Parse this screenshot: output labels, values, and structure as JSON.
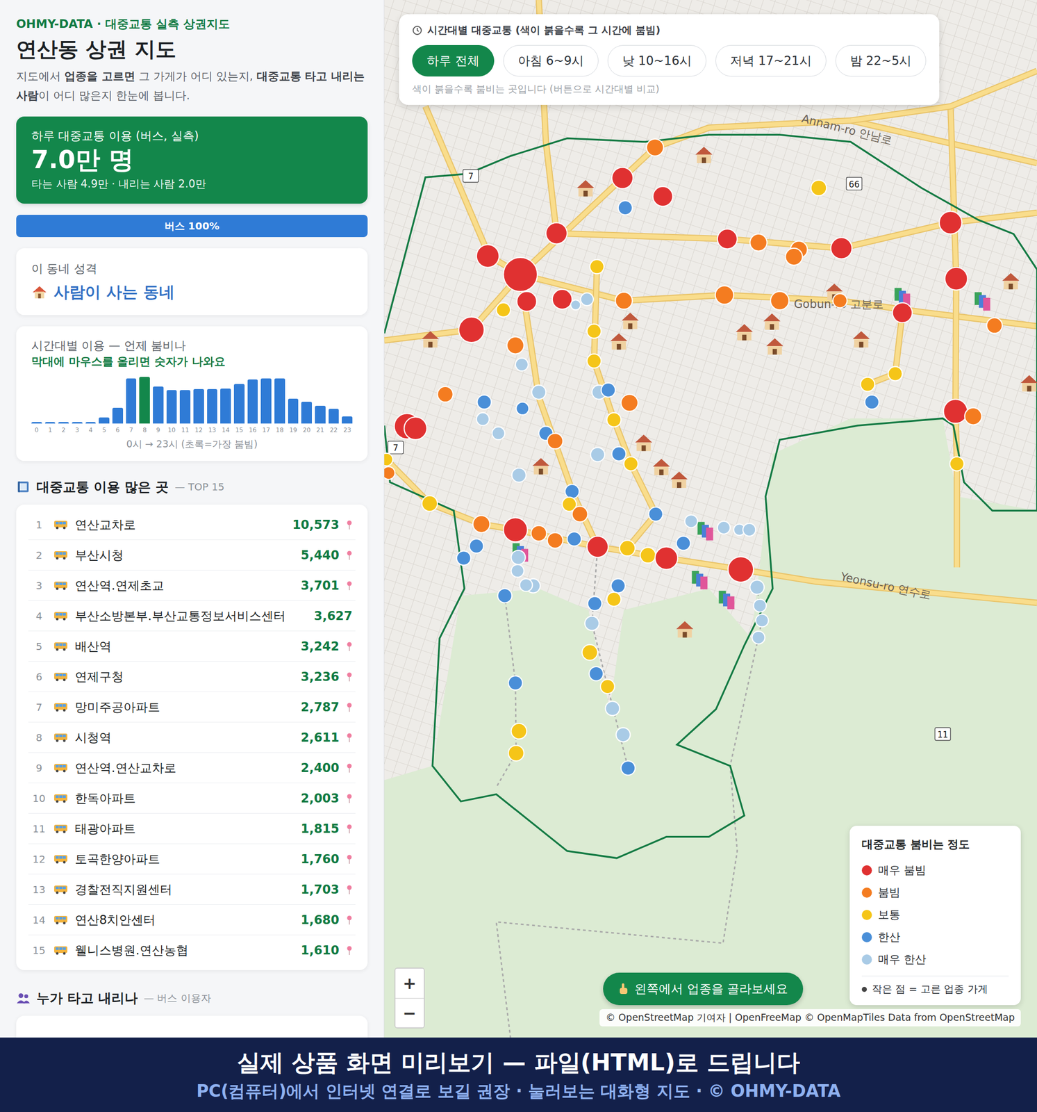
{
  "header": {
    "kicker": "OHMY-DATA · 대중교통 실측 상권지도",
    "title": "연산동 상권 지도",
    "description": [
      {
        "text": "지도에서 ",
        "bold": false
      },
      {
        "text": "업종을 고르면",
        "bold": true
      },
      {
        "text": " 그 가게가 어디 있는지, ",
        "bold": false
      },
      {
        "text": "대중교통 타고 내리는 사람",
        "bold": true
      },
      {
        "text": "이 어디 많은지 한눈에 봅니다.",
        "bold": false
      }
    ]
  },
  "summary": {
    "label": "하루 대중교통 이용 (버스, 실측)",
    "value": "7.0만 명",
    "detail": "타는 사람 4.9만 · 내리는 사람 2.0만"
  },
  "mode_share": [
    {
      "label": "버스 100%",
      "level": 1.0,
      "color": "#2f7bd6"
    }
  ],
  "neighborhood": {
    "label": "이 동네 성격",
    "value": "사람이 사는 동네"
  },
  "hourly_chart": {
    "title": "시간대별 이용 — 언제 붐비나",
    "hint": "막대에 마우스를 올리면 숫자가 나와요",
    "values": [
      200,
      150,
      120,
      130,
      180,
      700,
      1800,
      5100,
      5300,
      4200,
      3800,
      3800,
      3900,
      3900,
      3950,
      4500,
      5000,
      5100,
      5100,
      2800,
      2500,
      2000,
      1700,
      800
    ],
    "ticks": [
      "0",
      "1",
      "2",
      "3",
      "4",
      "5",
      "6",
      "7",
      "8",
      "9",
      "10",
      "11",
      "12",
      "13",
      "14",
      "15",
      "16",
      "17",
      "18",
      "19",
      "20",
      "21",
      "22",
      "23"
    ],
    "caption": "0시 → 23시 (초록=가장 붐빔)"
  },
  "top_stops": {
    "title": "대중교통 이용 많은 곳",
    "subtitle": "— TOP 15",
    "rows": [
      {
        "rank": "1",
        "name": "연산교차로",
        "count": "10,573",
        "pin": true
      },
      {
        "rank": "2",
        "name": "부산시청",
        "count": "5,440",
        "pin": true
      },
      {
        "rank": "3",
        "name": "연산역.연제초교",
        "count": "3,701",
        "pin": true
      },
      {
        "rank": "4",
        "name": "부산소방본부.부산교통정보서비스센터",
        "count": "3,627",
        "pin": false
      },
      {
        "rank": "5",
        "name": "배산역",
        "count": "3,242",
        "pin": true
      },
      {
        "rank": "6",
        "name": "연제구청",
        "count": "3,236",
        "pin": true
      },
      {
        "rank": "7",
        "name": "망미주공아파트",
        "count": "2,787",
        "pin": true
      },
      {
        "rank": "8",
        "name": "시청역",
        "count": "2,611",
        "pin": true
      },
      {
        "rank": "9",
        "name": "연산역.연산교차로",
        "count": "2,400",
        "pin": true
      },
      {
        "rank": "10",
        "name": "한독아파트",
        "count": "2,003",
        "pin": true
      },
      {
        "rank": "11",
        "name": "태광아파트",
        "count": "1,815",
        "pin": true
      },
      {
        "rank": "12",
        "name": "토곡한양아파트",
        "count": "1,760",
        "pin": true
      },
      {
        "rank": "13",
        "name": "경찰전직지원센터",
        "count": "1,703",
        "pin": true
      },
      {
        "rank": "14",
        "name": "연산8치안센터",
        "count": "1,680",
        "pin": true
      },
      {
        "rank": "15",
        "name": "웰니스병원.연산농협",
        "count": "1,610",
        "pin": true
      }
    ]
  },
  "riders": {
    "title": "누가 타고 내리나",
    "subtitle": "— 버스 이용자"
  },
  "map": {
    "time_filter": {
      "title": "시간대별 대중교통 (색이 붉을수록 그 시간에 붐빔)",
      "options": [
        {
          "label": "하루 전체",
          "selected": true
        },
        {
          "label": "아침 6~9시",
          "selected": false
        },
        {
          "label": "낮 10~16시",
          "selected": false
        },
        {
          "label": "저녁 17~21시",
          "selected": false
        },
        {
          "label": "밤 22~5시",
          "selected": false
        }
      ],
      "hint": "색이 붉을수록 붐비는 곳입니다 (버튼으로 시간대별 비교)"
    },
    "labels": [
      {
        "text": "Annam-ro 안남로"
      },
      {
        "text": "Gobun-ro 고분로"
      },
      {
        "text": "Yeonsu-ro 연수로"
      }
    ],
    "route_shields": [
      "7",
      "7",
      "66",
      "11"
    ],
    "stops": [
      {
        "color": "#f47c20"
      },
      {
        "color": "#e03131"
      },
      {
        "color": "#e03131"
      },
      {
        "color": "#4a8fd8"
      },
      {
        "color": "#e03131"
      },
      {
        "color": "#e03131"
      },
      {
        "color": "#f47c20"
      },
      {
        "color": "#f47c20"
      },
      {
        "color": "#f47c20"
      },
      {
        "color": "#e03131"
      },
      {
        "color": "#f5c518"
      },
      {
        "color": "#e03131"
      },
      {
        "color": "#e03131"
      },
      {
        "color": "#f47c20"
      },
      {
        "color": "#e03131"
      },
      {
        "color": "#f5c518"
      },
      {
        "color": "#f5c518"
      },
      {
        "color": "#4a8fd8"
      },
      {
        "color": "#e03131"
      },
      {
        "color": "#f47c20"
      },
      {
        "color": "#f5c518"
      },
      {
        "color": "#e03131"
      },
      {
        "color": "#e03131"
      },
      {
        "color": "#e03131"
      },
      {
        "color": "#e03131"
      },
      {
        "color": "#e03131"
      },
      {
        "color": "#f5c518"
      },
      {
        "color": "#f47c20"
      },
      {
        "color": "#a9cbe6"
      },
      {
        "color": "#a9cbe6"
      },
      {
        "color": "#4a8fd8"
      },
      {
        "color": "#4a8fd8"
      },
      {
        "color": "#a9cbe6"
      },
      {
        "color": "#a9cbe6"
      },
      {
        "color": "#f47c20"
      },
      {
        "color": "#e03131"
      },
      {
        "color": "#e03131"
      },
      {
        "color": "#4a8fd8"
      },
      {
        "color": "#f47c20"
      },
      {
        "color": "#a9cbe6"
      },
      {
        "color": "#4a8fd8"
      },
      {
        "color": "#f5c518"
      },
      {
        "color": "#f47c20"
      },
      {
        "color": "#f5c518"
      },
      {
        "color": "#f47c20"
      },
      {
        "color": "#e03131"
      },
      {
        "color": "#f47c20"
      },
      {
        "color": "#f47c20"
      },
      {
        "color": "#4a8fd8"
      },
      {
        "color": "#4a8fd8"
      },
      {
        "color": "#4a8fd8"
      },
      {
        "color": "#a9cbe6"
      },
      {
        "color": "#a9cbe6"
      },
      {
        "color": "#a9cbe6"
      },
      {
        "color": "#a9cbe6"
      },
      {
        "color": "#4a8fd8"
      },
      {
        "color": "#e03131"
      },
      {
        "color": "#f5c518"
      },
      {
        "color": "#f5c518"
      },
      {
        "color": "#e03131"
      },
      {
        "color": "#e03131"
      },
      {
        "color": "#4a8fd8"
      },
      {
        "color": "#a9cbe6"
      },
      {
        "color": "#a9cbe6"
      },
      {
        "color": "#a9cbe6"
      },
      {
        "color": "#a9cbe6"
      },
      {
        "color": "#4a8fd8"
      },
      {
        "color": "#4a8fd8"
      },
      {
        "color": "#f5c518"
      },
      {
        "color": "#4a8fd8"
      },
      {
        "color": "#a9cbe6"
      },
      {
        "color": "#f5c518"
      },
      {
        "color": "#4a8fd8"
      },
      {
        "color": "#f5c518"
      },
      {
        "color": "#a9cbe6"
      },
      {
        "color": "#a9cbe6"
      },
      {
        "color": "#4a8fd8"
      },
      {
        "color": "#4a8fd8"
      },
      {
        "color": "#f5c518"
      },
      {
        "color": "#f5c518"
      },
      {
        "color": "#a9cbe6"
      },
      {
        "color": "#a9cbe6"
      },
      {
        "color": "#a9cbe6"
      },
      {
        "color": "#a9cbe6"
      },
      {
        "color": "#a9cbe6"
      },
      {
        "color": "#a9cbe6"
      },
      {
        "color": "#f47c20"
      },
      {
        "color": "#f5c518"
      },
      {
        "color": "#f5c518"
      },
      {
        "color": "#f5c518"
      },
      {
        "color": "#a9cbe6"
      },
      {
        "color": "#4a8fd8"
      },
      {
        "color": "#f5c518"
      },
      {
        "color": "#f47c20"
      },
      {
        "color": "#a9cbe6"
      },
      {
        "color": "#4a8fd8"
      },
      {
        "color": "#f5c518"
      },
      {
        "color": "#f47c20"
      },
      {
        "color": "#f47c20"
      },
      {
        "color": "#f47c20"
      },
      {
        "color": "#f5c518"
      },
      {
        "color": "#f47c20"
      }
    ],
    "legend": {
      "title": "대중교통 붐비는 정도",
      "items": [
        {
          "label": "매우 붐빔",
          "color": "#e03131"
        },
        {
          "label": "붐빔",
          "color": "#f47c20"
        },
        {
          "label": "보통",
          "color": "#f5c518"
        },
        {
          "label": "한산",
          "color": "#4a8fd8"
        },
        {
          "label": "매우 한산",
          "color": "#a9cbe6"
        }
      ],
      "note": "작은 점 = 고른 업종 가게"
    },
    "zoom": [
      "+",
      "−"
    ],
    "cta": "왼쪽에서 업종을 골라보세요",
    "attribution": "© OpenStreetMap 기여자 | OpenFreeMap © OpenMapTiles Data from OpenStreetMap"
  },
  "banner": {
    "title": "실제 상품 화면 미리보기 — 파일(HTML)로 드립니다",
    "subtitle": "PC(컴퓨터)에서 인터넷 연결로 보길 권장 · 눌러보는 대화형 지도 · © OHMY-DATA"
  }
}
